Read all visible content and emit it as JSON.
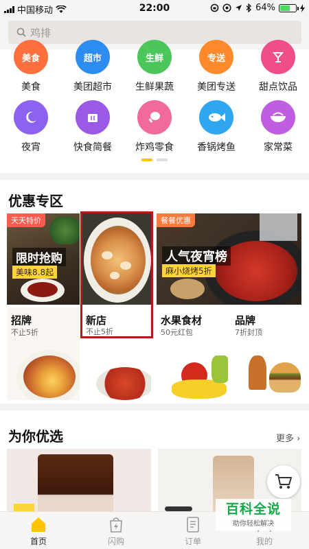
{
  "status_bar": {
    "carrier": "中国移动",
    "time": "22:00",
    "battery": "64%",
    "battery_level": 0.64
  },
  "search": {
    "placeholder": "鸡排"
  },
  "categories": [
    {
      "label": "美食",
      "icon": "food-icon",
      "badge": "美食",
      "color": "#ff6f3d"
    },
    {
      "label": "美团超市",
      "icon": "supermarket-icon",
      "badge": "超市",
      "color": "#2d8cf0"
    },
    {
      "label": "生鲜果蔬",
      "icon": "fresh-produce-icon",
      "badge": "生鲜",
      "color": "#4bc65a"
    },
    {
      "label": "美团专送",
      "icon": "delivery-icon",
      "badge": "专送",
      "color": "#ff8a2b"
    },
    {
      "label": "甜点饮品",
      "icon": "dessert-drink-icon",
      "badge": "",
      "color": "#f04e8a"
    },
    {
      "label": "夜宵",
      "icon": "moon-icon",
      "color": "#8e62f0"
    },
    {
      "label": "快食简餐",
      "icon": "fast-food-icon",
      "color": "#9b59e8"
    },
    {
      "label": "炸鸡零食",
      "icon": "chicken-leg-icon",
      "color": "#f06a9b"
    },
    {
      "label": "香锅烤鱼",
      "icon": "fish-icon",
      "color": "#2ea6f0"
    },
    {
      "label": "家常菜",
      "icon": "bowl-icon",
      "color": "#c15de0"
    }
  ],
  "promo": {
    "title": "优惠专区",
    "tiles": [
      {
        "tag": "天天特价",
        "headline": "限时抢购",
        "sub": "美味8.8起"
      },
      {
        "title": "新店",
        "sub": "不止5折"
      },
      {
        "tag": "餐餐优惠",
        "headline": "人气夜宵榜",
        "sub": "麻小烧烤5折"
      }
    ],
    "small_tiles": [
      {
        "title": "招牌",
        "sub": "不止5折"
      },
      {
        "title": "水果食材",
        "sub": "50元红包"
      },
      {
        "title": "品牌",
        "sub": "7折封顶"
      }
    ]
  },
  "recommend": {
    "title": "为你优选",
    "more": "更多"
  },
  "nav": [
    {
      "label": "首页",
      "icon": "home-icon",
      "active": true
    },
    {
      "label": "闪购",
      "icon": "flash-bag-icon",
      "active": false
    },
    {
      "label": "订单",
      "icon": "order-icon",
      "active": false
    },
    {
      "label": "我的",
      "icon": "profile-icon",
      "active": false
    }
  ],
  "watermark": {
    "title": "百科全说",
    "sub": "助你轻松解决"
  },
  "colors": {
    "accent": "#ffc300",
    "highlight_box": "#b01f15",
    "watermark_green": "#14a84a"
  }
}
